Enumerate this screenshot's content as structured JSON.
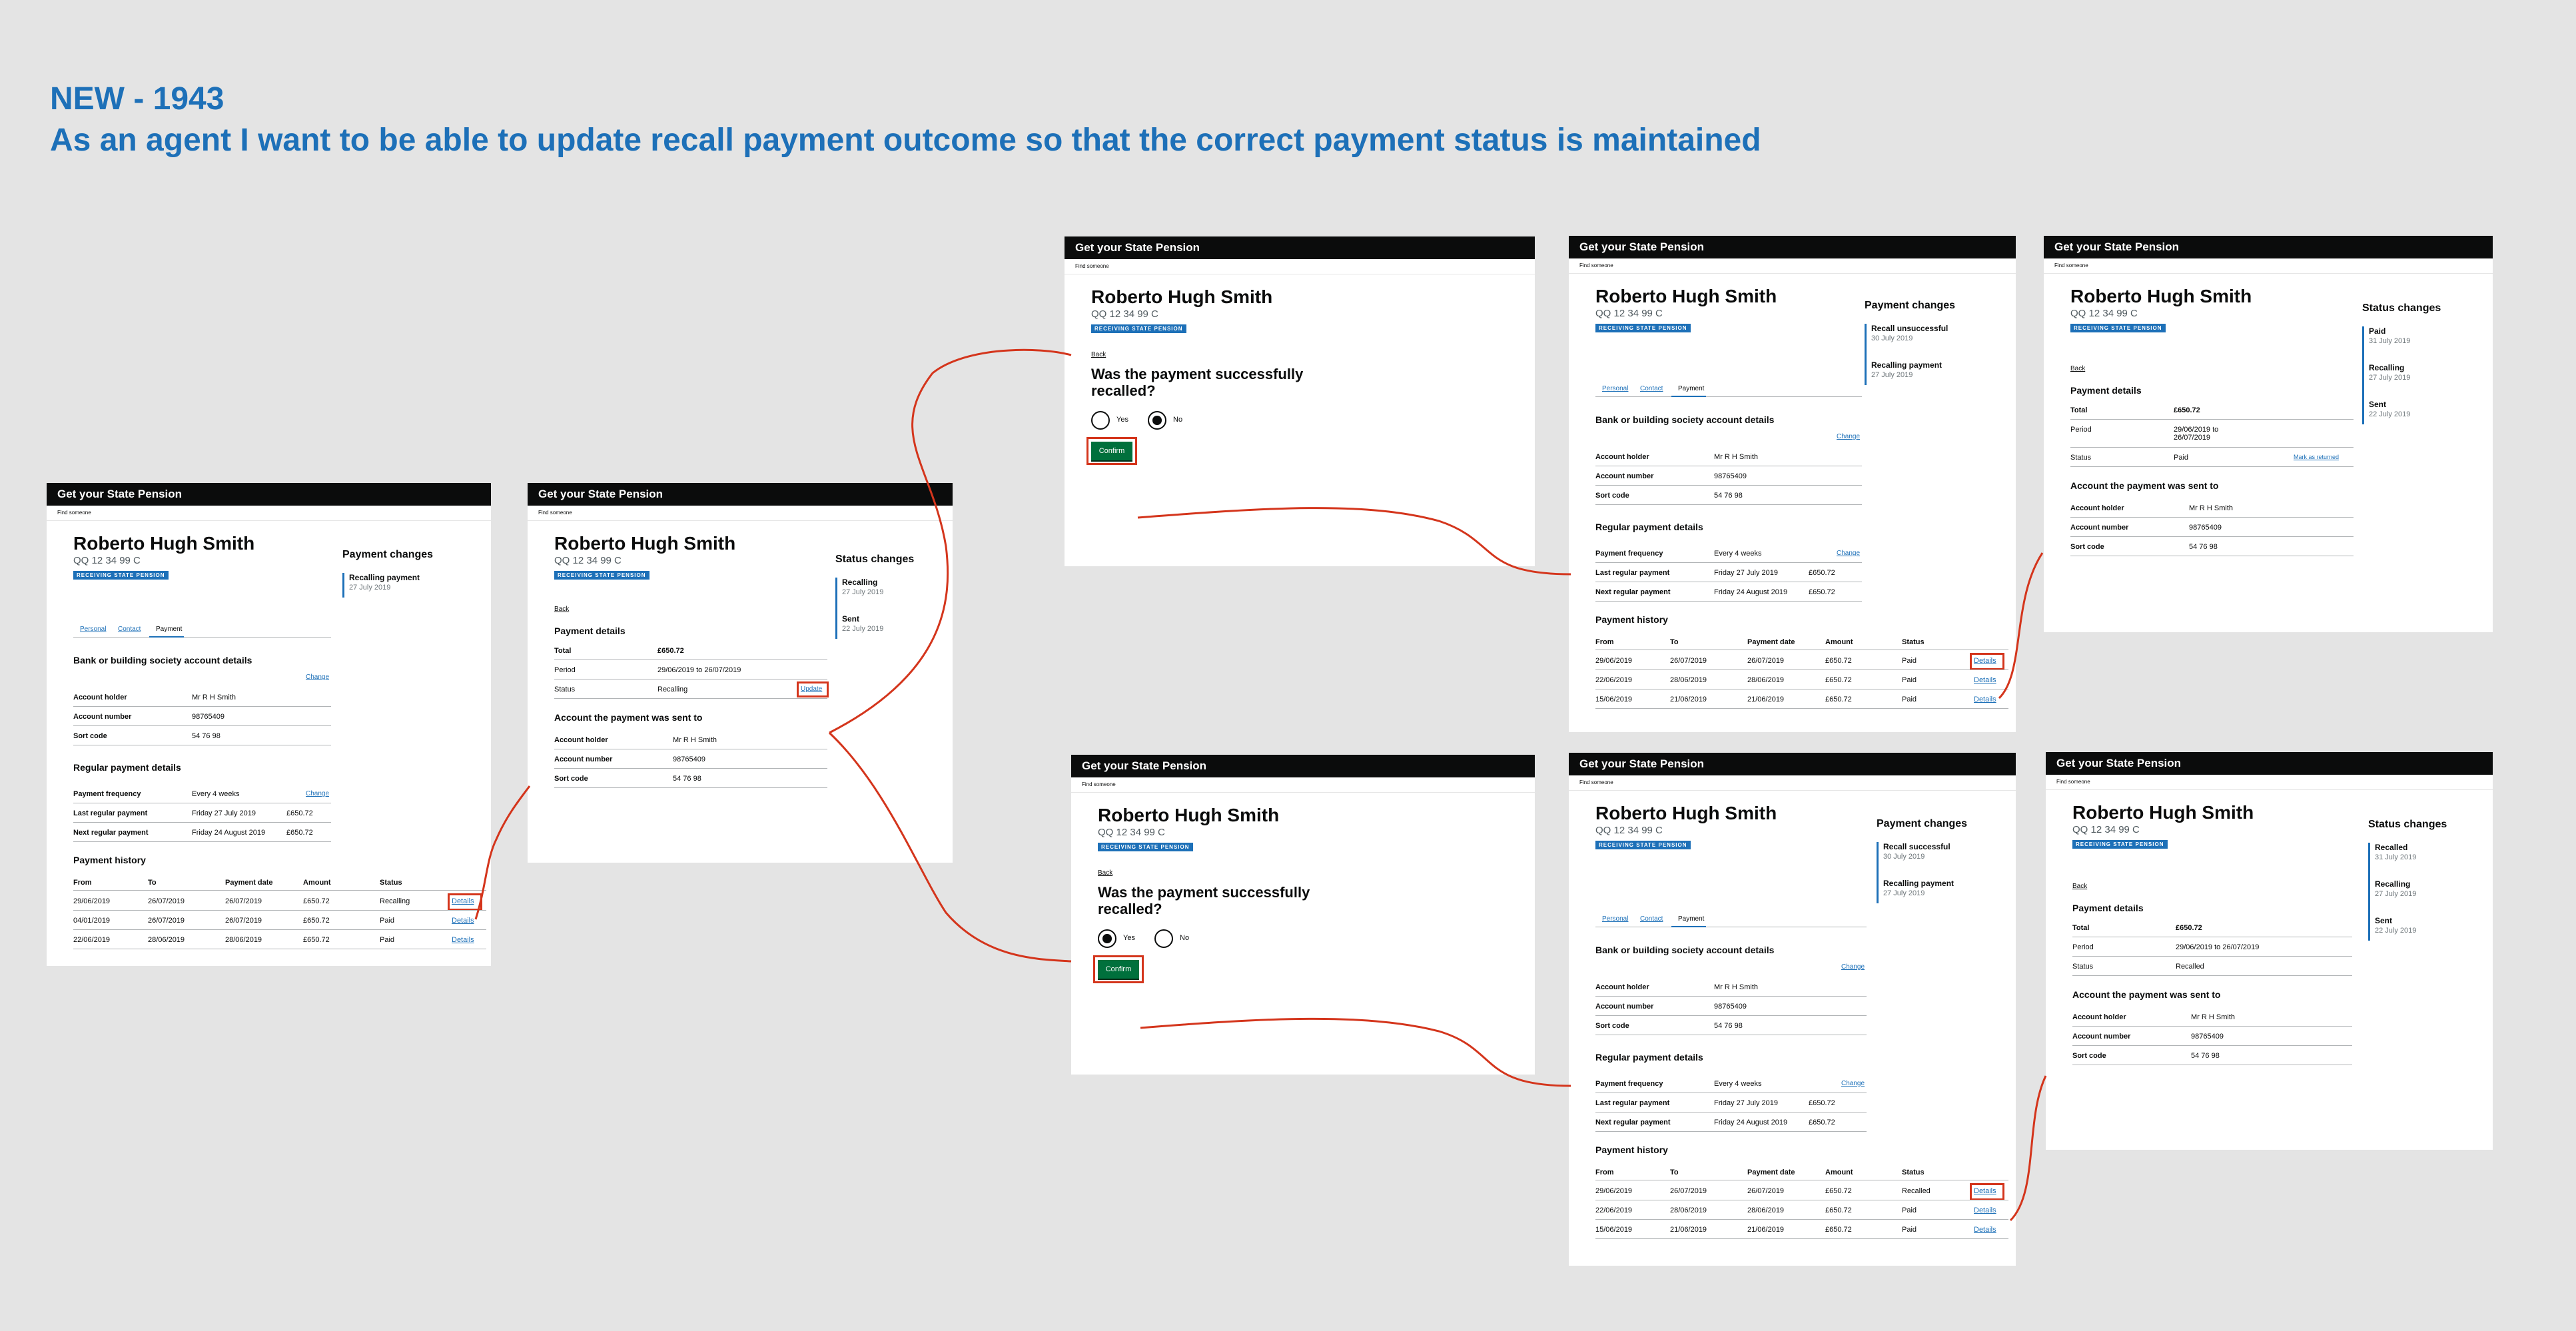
{
  "page": {
    "title_line1": "NEW - 1943",
    "title_line2": "As an agent I want to be able to update recall payment outcome so that the correct payment status is maintained"
  },
  "common": {
    "service": "Get your State Pension",
    "find": "Find someone",
    "name": "Roberto Hugh Smith",
    "nino": "QQ 12 34 99 C",
    "badge": "RECEIVING STATE PENSION",
    "back": "Back",
    "tabs": [
      "Personal",
      "Contact",
      "Payment"
    ],
    "bank_heading": "Bank or building society account details",
    "change": "Change",
    "acct_labels": [
      "Account holder",
      "Account number",
      "Sort code"
    ],
    "acct_values": [
      "Mr R H Smith",
      "98765409",
      "54 76 98"
    ],
    "regular_heading": "Regular payment details",
    "regular_labels": [
      "Payment frequency",
      "Last regular payment",
      "Next regular payment"
    ],
    "regular_values": [
      "Every 4 weeks",
      "Friday 27 July 2019",
      "Friday 24 August 2019"
    ],
    "regular_amount": "£650.72",
    "history_heading": "Payment history",
    "history_cols": [
      "From",
      "To",
      "Payment date",
      "Amount",
      "Status"
    ],
    "details": "Details",
    "payment_changes": "Payment changes",
    "status_changes": "Status changes",
    "payment_details": "Payment details",
    "total_label": "Total",
    "total_value": "£650.72",
    "period_label": "Period",
    "period_value": "29/06/2019 to 26/07/2019",
    "status_label": "Status",
    "sent_to": "Account the payment was sent to",
    "question": "Was the payment successfully recalled?",
    "yes": "Yes",
    "no": "No",
    "confirm": "Confirm",
    "update": "Update",
    "mark_returned": "Mark as returned"
  },
  "s1": {
    "changes": [
      {
        "t": "Recalling payment",
        "d": "27 July 2019"
      }
    ],
    "history": [
      [
        "29/06/2019",
        "26/07/2019",
        "26/07/2019",
        "£650.72",
        "Recalling"
      ],
      [
        "04/01/2019",
        "26/07/2019",
        "26/07/2019",
        "£650.72",
        "Paid"
      ],
      [
        "22/06/2019",
        "28/06/2019",
        "28/06/2019",
        "£650.72",
        "Paid"
      ]
    ]
  },
  "s2": {
    "status": "Recalling",
    "changes": [
      {
        "t": "Recalling",
        "d": "27 July 2019"
      },
      {
        "t": "Sent",
        "d": "22 July 2019"
      }
    ]
  },
  "s4": {
    "changes": [
      {
        "t": "Recall unsuccessful",
        "d": "30 July 2019"
      },
      {
        "t": "Recalling payment",
        "d": "27 July 2019"
      }
    ],
    "history": [
      [
        "29/06/2019",
        "26/07/2019",
        "26/07/2019",
        "£650.72",
        "Paid"
      ],
      [
        "22/06/2019",
        "28/06/2019",
        "28/06/2019",
        "£650.72",
        "Paid"
      ],
      [
        "15/06/2019",
        "21/06/2019",
        "21/06/2019",
        "£650.72",
        "Paid"
      ]
    ]
  },
  "s5": {
    "period": "29/06/2019 to 26/07/2019",
    "status": "Paid",
    "changes": [
      {
        "t": "Paid",
        "d": "31 July 2019"
      },
      {
        "t": "Recalling",
        "d": "27 July 2019"
      },
      {
        "t": "Sent",
        "d": "22 July 2019"
      }
    ]
  },
  "s7": {
    "changes": [
      {
        "t": "Recall successful",
        "d": "30 July 2019"
      },
      {
        "t": "Recalling payment",
        "d": "27 July 2019"
      }
    ],
    "history": [
      [
        "29/06/2019",
        "26/07/2019",
        "26/07/2019",
        "£650.72",
        "Recalled"
      ],
      [
        "22/06/2019",
        "28/06/2019",
        "28/06/2019",
        "£650.72",
        "Paid"
      ],
      [
        "15/06/2019",
        "21/06/2019",
        "21/06/2019",
        "£650.72",
        "Paid"
      ]
    ]
  },
  "s8": {
    "status": "Recalled",
    "changes": [
      {
        "t": "Recalled",
        "d": "31 July 2019"
      },
      {
        "t": "Recalling",
        "d": "27 July 2019"
      },
      {
        "t": "Sent",
        "d": "22 July 2019"
      }
    ]
  },
  "colors": {
    "brand": "#1d70b8",
    "header": "#0b0c0c",
    "button": "#00703c",
    "highlight": "#d4351c"
  }
}
